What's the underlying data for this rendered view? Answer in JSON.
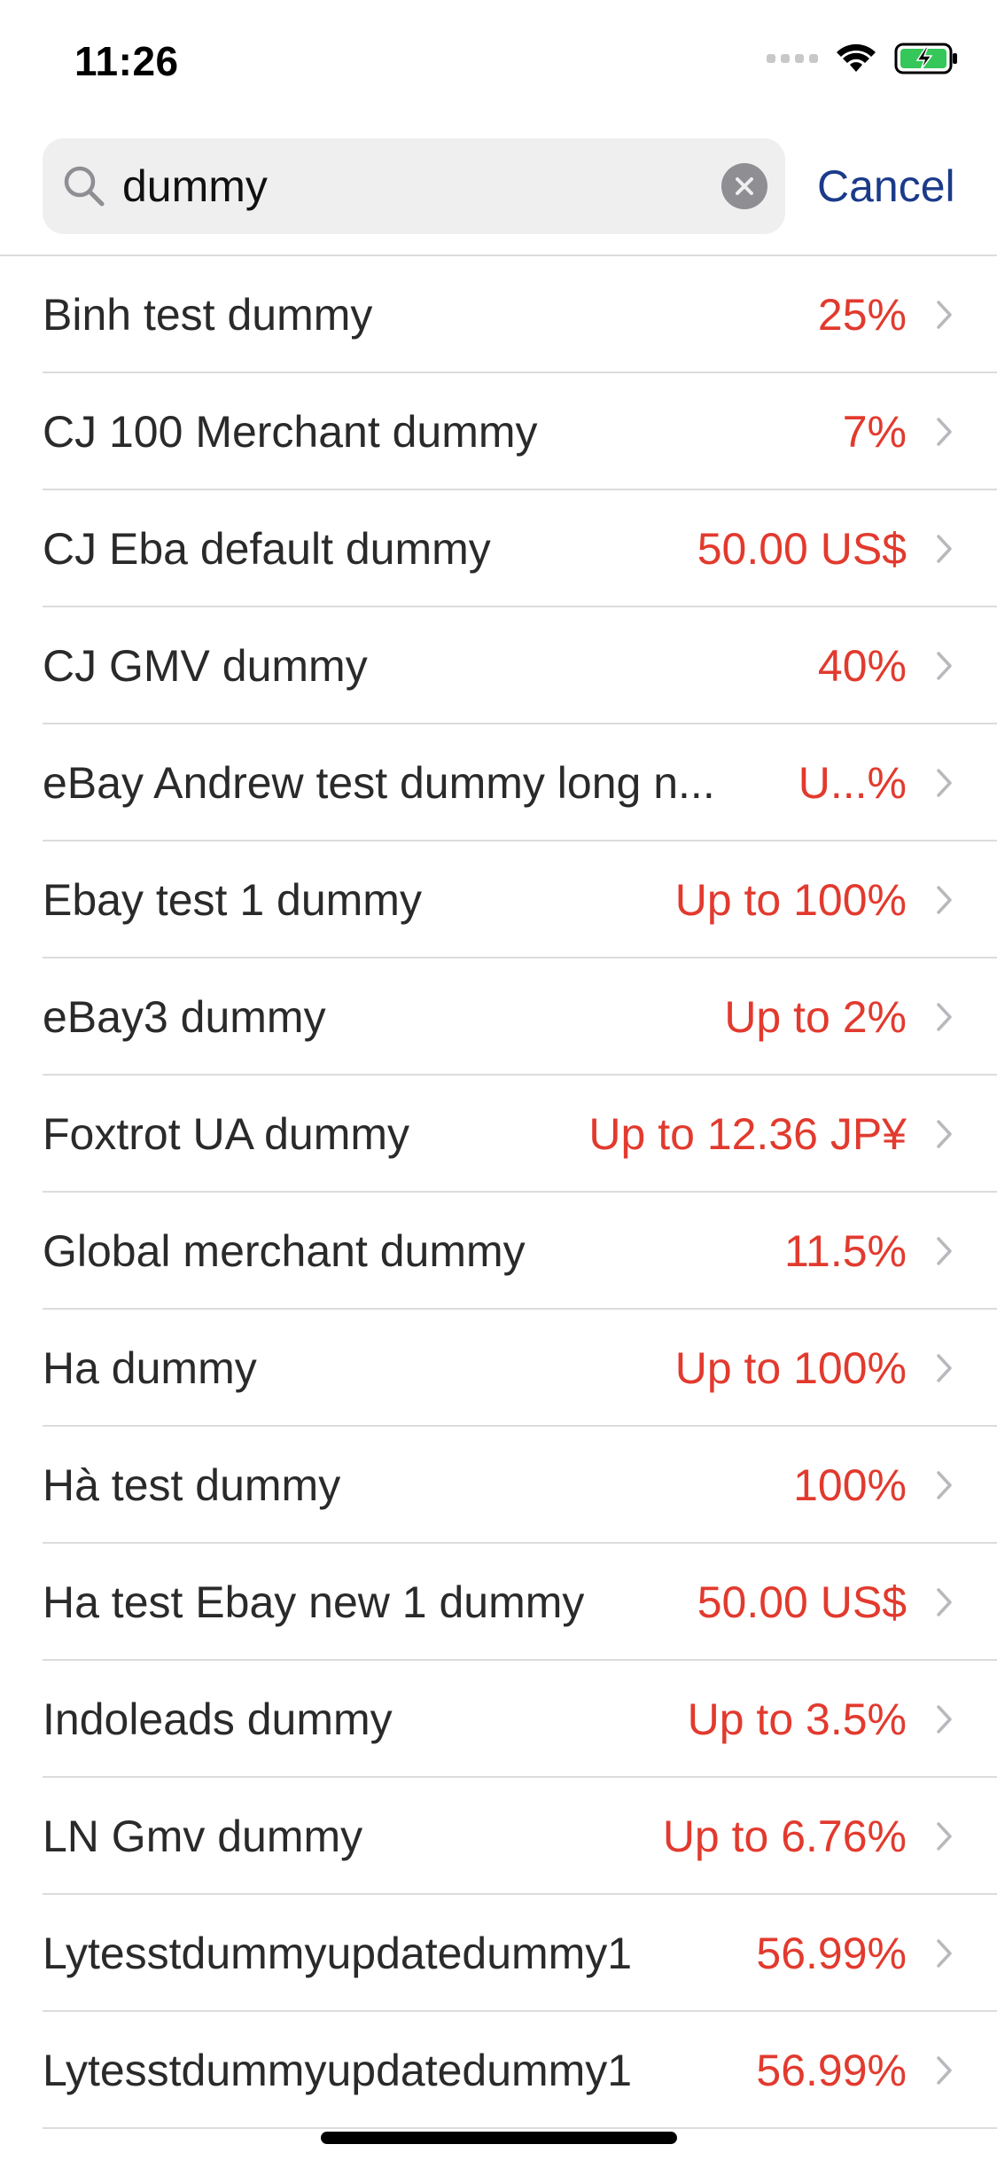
{
  "status_bar": {
    "time": "11:26"
  },
  "search": {
    "value": "dummy",
    "cancel_label": "Cancel"
  },
  "results": [
    {
      "name": "Binh test dummy",
      "value": "25%"
    },
    {
      "name": "CJ 100 Merchant dummy",
      "value": "7%"
    },
    {
      "name": "CJ Eba default dummy",
      "value": "50.00 US$"
    },
    {
      "name": "CJ GMV dummy",
      "value": "40%"
    },
    {
      "name": "eBay Andrew test dummy long n...",
      "value": "U...%"
    },
    {
      "name": "Ebay test 1 dummy",
      "value": "Up to 100%"
    },
    {
      "name": "eBay3 dummy",
      "value": "Up to 2%"
    },
    {
      "name": "Foxtrot UA dummy",
      "value": "Up to 12.36 JP¥"
    },
    {
      "name": "Global merchant dummy",
      "value": "11.5%"
    },
    {
      "name": "Ha dummy",
      "value": "Up to 100%"
    },
    {
      "name": "Hà test dummy",
      "value": "100%"
    },
    {
      "name": "Ha test Ebay new 1 dummy",
      "value": "50.00 US$"
    },
    {
      "name": "Indoleads dummy",
      "value": "Up to 3.5%"
    },
    {
      "name": "LN Gmv dummy",
      "value": "Up to 6.76%"
    },
    {
      "name": "Lytesstdummyupdatedummy1",
      "value": "56.99%"
    },
    {
      "name": "Lytesstdummyupdatedummy1",
      "value": "56.99%"
    }
  ],
  "colors": {
    "accent_value": "#e23a2e",
    "cancel_link": "#1b3a8a",
    "battery_charging": "#35c759"
  },
  "icons": {
    "status": [
      "signal-dots-icon",
      "wifi-icon",
      "battery-charging-icon"
    ],
    "search": "search-icon",
    "clear": "clear-icon",
    "row": "chevron-right-icon"
  }
}
